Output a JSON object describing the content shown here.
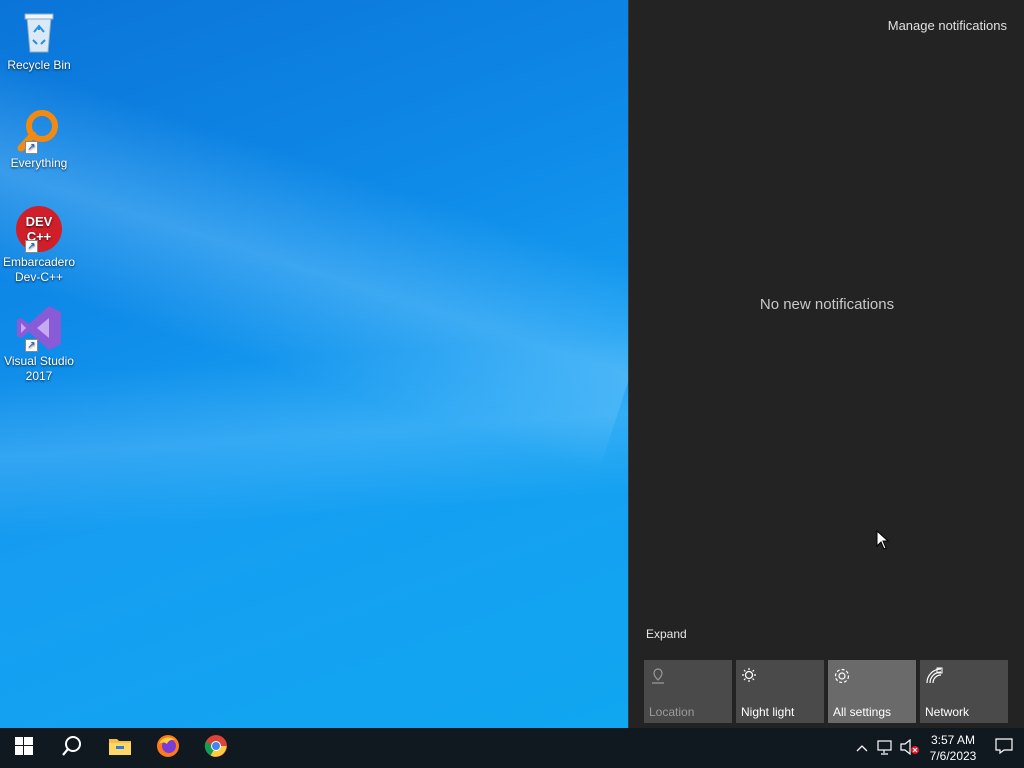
{
  "desktop": {
    "icons": [
      {
        "label": "Recycle Bin",
        "icon": "recycle-bin-icon"
      },
      {
        "label": "Everything",
        "icon": "everything-icon"
      },
      {
        "label": "Embarcadero Dev-C++",
        "icon": "devcpp-icon",
        "badge": "DEV C++"
      },
      {
        "label": "Visual Studio 2017",
        "icon": "visual-studio-icon"
      }
    ]
  },
  "action_center": {
    "manage_label": "Manage notifications",
    "empty_message": "No new notifications",
    "expand_label": "Expand",
    "tiles": [
      {
        "label": "Location",
        "icon": "location-icon",
        "state": "disabled"
      },
      {
        "label": "Night light",
        "icon": "night-light-icon",
        "state": "normal"
      },
      {
        "label": "All settings",
        "icon": "gear-icon",
        "state": "active"
      },
      {
        "label": "Network",
        "icon": "network-icon",
        "state": "normal"
      }
    ]
  },
  "taskbar": {
    "pinned": [
      {
        "icon": "windows-start-icon"
      },
      {
        "icon": "search-icon"
      },
      {
        "icon": "file-explorer-icon"
      },
      {
        "icon": "firefox-icon"
      },
      {
        "icon": "chrome-icon"
      }
    ],
    "clock": {
      "time": "3:57 AM",
      "date": "7/6/2023"
    }
  },
  "colors": {
    "action_center_bg": "#232323",
    "tile_bg": "#4a4a4a",
    "taskbar_bg": "#101820"
  }
}
